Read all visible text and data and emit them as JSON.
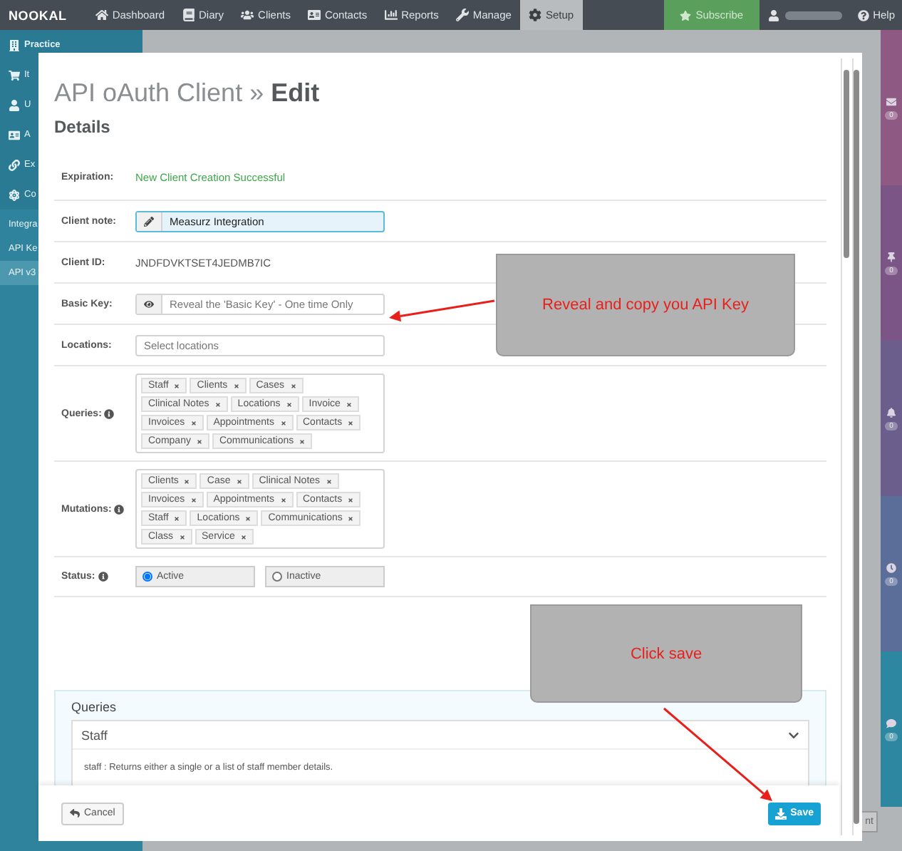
{
  "nav": {
    "logo": "NOOKAL",
    "items": [
      {
        "label": "Dashboard",
        "selected": false
      },
      {
        "label": "Diary",
        "selected": false
      },
      {
        "label": "Clients",
        "selected": false
      },
      {
        "label": "Contacts",
        "selected": false
      },
      {
        "label": "Reports",
        "selected": false
      },
      {
        "label": "Manage",
        "selected": false
      },
      {
        "label": "Setup",
        "selected": true
      }
    ],
    "subscribe": "Subscribe",
    "help": "Help"
  },
  "sidebar": {
    "items": [
      {
        "label": "Practice"
      },
      {
        "label": "It"
      },
      {
        "label": "U"
      },
      {
        "label": "A"
      },
      {
        "label": "Ex"
      },
      {
        "label": "Co"
      }
    ],
    "sub_items": [
      {
        "label": "Integra",
        "selected": false
      },
      {
        "label": "API Ke",
        "selected": false
      },
      {
        "label": "API v3",
        "selected": true
      }
    ]
  },
  "right_strip": [
    {
      "badge": "0",
      "color": "#8e5a84"
    },
    {
      "badge": "0",
      "color": "#7b5585"
    },
    {
      "badge": "0",
      "color": "#6b5d8c"
    },
    {
      "badge": "0",
      "color": "#5b6e9a"
    },
    {
      "badge": "0",
      "color": "#2d87a1"
    }
  ],
  "background_button": "nt",
  "modal": {
    "title": "API oAuth Client » **Edit**",
    "section": "Details",
    "rows": [
      {
        "kind": "success",
        "label": "Expiration:",
        "info": false,
        "value": "New Client Creation Successful"
      },
      {
        "kind": "input",
        "label": "Client note:",
        "info": false,
        "value": "Measurz Integration",
        "focused": true
      },
      {
        "kind": "text",
        "label": "Client ID:",
        "info": false,
        "value": "JNDFDVKTSET4JEDMB7IC"
      },
      {
        "kind": "input",
        "label": "Basic Key:",
        "info": false,
        "placeholder": "Reveal the 'Basic Key' - One time Only",
        "focused": false
      },
      {
        "kind": "input",
        "label": "Locations:",
        "info": false,
        "placeholder": "Select locations",
        "focused": false
      },
      {
        "kind": "tags",
        "label": "Queries:",
        "info": true,
        "tag_lines": [
          [
            "Staff",
            "Clients",
            "Cases"
          ],
          [
            "Clinical Notes",
            "Locations",
            "Invoice"
          ],
          [
            "Invoices",
            "Appointments",
            "Contacts"
          ],
          [
            "Company",
            "Communications"
          ]
        ]
      },
      {
        "kind": "tags",
        "label": "Mutations:",
        "info": true,
        "tag_lines": [
          [
            "Clients",
            "Case",
            "Clinical Notes"
          ],
          [
            "Invoices",
            "Appointments",
            "Contacts"
          ],
          [
            "Staff",
            "Locations",
            "Communications"
          ],
          [
            "Class",
            "Service"
          ]
        ]
      },
      {
        "kind": "radios",
        "label": "Status:",
        "info": true,
        "options": [
          {
            "label": "Active",
            "selected": true
          },
          {
            "label": "Inactive",
            "selected": false
          }
        ]
      }
    ],
    "panel": {
      "title": "Queries",
      "accordion": {
        "title": "Staff",
        "expanded": true,
        "body": "staff : Returns either a single or a list of staff member details."
      }
    },
    "footer": {
      "cancel": "Cancel",
      "save": "Save"
    }
  },
  "annotations": [
    {
      "text": "Reveal and copy you API Key"
    },
    {
      "text": "Click save"
    }
  ]
}
